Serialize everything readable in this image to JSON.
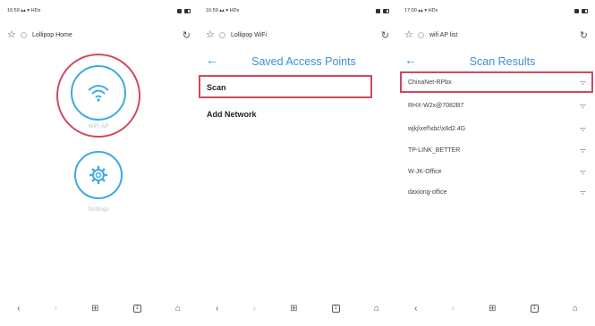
{
  "screens": [
    {
      "status": {
        "time": "16:59",
        "signal": "☷☷ ▾",
        "net": "HDs"
      },
      "address": "Lollipop Home",
      "tiles": {
        "wifi_label": "WiFi AP",
        "settings_label": "Settings"
      }
    },
    {
      "status": {
        "time": "16:59",
        "signal": "☷☷ ▾",
        "net": "HDs"
      },
      "address": "Lollipop WiFi",
      "title": "Saved Access Points",
      "items": [
        "Scan",
        "Add Network"
      ]
    },
    {
      "status": {
        "time": "17:00",
        "signal": "☷☷ ▾",
        "net": "HDs"
      },
      "address": "wifi AP list",
      "title": "Scan Results",
      "networks": [
        "ChinaNet-RPbx",
        "RHX-W2x@7082B7",
        "wjkj\\xef\\xbc\\x8d2.4G",
        "TP-LINK_BETTER",
        "W-JK-Office",
        "daxiong-office"
      ]
    }
  ],
  "colors": {
    "accent": "#3b8fd8",
    "highlight": "#d1495e",
    "icon_ring": "#3fa9e2"
  }
}
